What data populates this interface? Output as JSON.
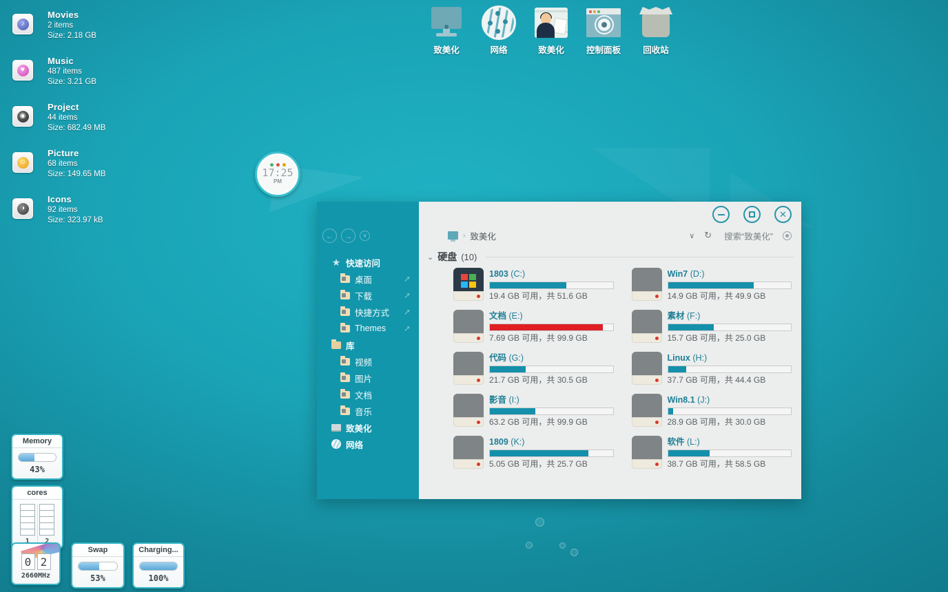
{
  "desktop": {
    "folders": [
      {
        "name": "Movies",
        "items": "2 items",
        "size": "Size: 2.18 GB",
        "glyph": "♪",
        "icon_name": "movies-folder-icon"
      },
      {
        "name": "Music",
        "items": "487 items",
        "size": "Size: 3.21 GB",
        "glyph": "♥",
        "icon_name": "music-folder-icon"
      },
      {
        "name": "Project",
        "items": "44 items",
        "size": "Size: 682.49 MB",
        "glyph": "◉",
        "icon_name": "project-folder-icon"
      },
      {
        "name": "Picture",
        "items": "68 items",
        "size": "Size: 149.65 MB",
        "glyph": "☺",
        "icon_name": "picture-folder-icon"
      },
      {
        "name": "Icons",
        "items": "92 items",
        "size": "Size: 323.97 kB",
        "glyph": "◑",
        "icon_name": "icons-folder-icon"
      }
    ],
    "top_icons": [
      {
        "label": "致美化",
        "icon_name": "computer-icon"
      },
      {
        "label": "网络",
        "icon_name": "network-globe-icon"
      },
      {
        "label": "致美化",
        "icon_name": "user-person-icon"
      },
      {
        "label": "控制面板",
        "icon_name": "control-panel-icon"
      },
      {
        "label": "回收站",
        "icon_name": "recycle-bin-icon"
      }
    ]
  },
  "clock": {
    "time": "17:25",
    "ampm": "PM",
    "dots": [
      "#49b36a",
      "#d9534f",
      "#e0a800"
    ]
  },
  "widgets": {
    "memory": {
      "title": "Memory",
      "value": "43%",
      "percent": 43
    },
    "cores": {
      "title": "cores",
      "labels": [
        "1",
        "2"
      ]
    },
    "cpu": {
      "digits": [
        "0",
        "2"
      ],
      "freq": "2660MHz"
    },
    "swap": {
      "title": "Swap",
      "value": "53%",
      "percent": 53
    },
    "battery": {
      "title": "Charging...",
      "value": "100%",
      "percent": 100
    }
  },
  "explorer": {
    "nav": {
      "back": "←",
      "forward": "→",
      "recent": "∨"
    },
    "window_controls": [
      {
        "name": "minimize-button",
        "glyph": "−"
      },
      {
        "name": "maximize-button",
        "glyph": "□"
      },
      {
        "name": "close-button",
        "glyph": "✕"
      }
    ],
    "address": {
      "path": "致美化",
      "separator": "›",
      "chevron": "∨",
      "refresh": "↻",
      "search_placeholder": "搜索“致美化”"
    },
    "sidebar": [
      {
        "label": "快速访问",
        "type": "head",
        "icon": "star-icon",
        "pinned": false
      },
      {
        "label": "桌面",
        "type": "child",
        "icon": "folder-icon",
        "pinned": true
      },
      {
        "label": "下载",
        "type": "child",
        "icon": "folder-icon",
        "pinned": true
      },
      {
        "label": "快捷方式",
        "type": "child",
        "icon": "folder-icon",
        "pinned": true
      },
      {
        "label": "Themes",
        "type": "child",
        "icon": "folder-icon",
        "pinned": true
      },
      {
        "label": "库",
        "type": "head",
        "icon": "library-icon",
        "pinned": false
      },
      {
        "label": "视频",
        "type": "child",
        "icon": "folder-icon",
        "pinned": false
      },
      {
        "label": "图片",
        "type": "child",
        "icon": "folder-icon",
        "pinned": false
      },
      {
        "label": "文档",
        "type": "child",
        "icon": "folder-icon",
        "pinned": false
      },
      {
        "label": "音乐",
        "type": "child",
        "icon": "folder-icon",
        "pinned": false
      },
      {
        "label": "致美化",
        "type": "head",
        "icon": "computer-icon",
        "pinned": false
      },
      {
        "label": "网络",
        "type": "head",
        "icon": "network-icon",
        "pinned": false
      }
    ],
    "group": {
      "caret": "⌄",
      "title": "硬盘",
      "count": "(10)"
    },
    "drives": [
      {
        "label": "1803",
        "letter": "(C:)",
        "used_percent": 62,
        "warn": false,
        "windows": true,
        "detail": "19.4 GB 可用，共 51.6 GB",
        "free": "19.4 GB",
        "total": "51.6 GB"
      },
      {
        "label": "Win7",
        "letter": "(D:)",
        "used_percent": 70,
        "warn": false,
        "windows": false,
        "detail": "14.9 GB 可用，共 49.9 GB",
        "free": "14.9 GB",
        "total": "49.9 GB"
      },
      {
        "label": "文档",
        "letter": "(E:)",
        "used_percent": 92,
        "warn": true,
        "windows": false,
        "detail": "7.69 GB 可用，共 99.9 GB",
        "free": "7.69 GB",
        "total": "99.9 GB"
      },
      {
        "label": "素材",
        "letter": "(F:)",
        "used_percent": 37,
        "warn": false,
        "windows": false,
        "detail": "15.7 GB 可用，共 25.0 GB",
        "free": "15.7 GB",
        "total": "25.0 GB"
      },
      {
        "label": "代码",
        "letter": "(G:)",
        "used_percent": 29,
        "warn": false,
        "windows": false,
        "detail": "21.7 GB 可用，共 30.5 GB",
        "free": "21.7 GB",
        "total": "30.5 GB"
      },
      {
        "label": "Linux",
        "letter": "(H:)",
        "used_percent": 15,
        "warn": false,
        "windows": false,
        "detail": "37.7 GB 可用，共 44.4 GB",
        "free": "37.7 GB",
        "total": "44.4 GB"
      },
      {
        "label": "影音",
        "letter": "(I:)",
        "used_percent": 37,
        "warn": false,
        "windows": false,
        "detail": "63.2 GB 可用，共 99.9 GB",
        "free": "63.2 GB",
        "total": "99.9 GB"
      },
      {
        "label": "Win8.1",
        "letter": "(J:)",
        "used_percent": 4,
        "warn": false,
        "windows": false,
        "detail": "28.9 GB 可用，共 30.0 GB",
        "free": "28.9 GB",
        "total": "30.0 GB"
      },
      {
        "label": "1809",
        "letter": "(K:)",
        "used_percent": 80,
        "warn": false,
        "windows": false,
        "detail": "5.05 GB 可用，共 25.7 GB",
        "free": "5.05 GB",
        "total": "25.7 GB"
      },
      {
        "label": "软件",
        "letter": "(L:)",
        "used_percent": 34,
        "warn": false,
        "windows": false,
        "detail": "38.7 GB 可用，共 58.5 GB",
        "free": "38.7 GB",
        "total": "58.5 GB"
      }
    ]
  },
  "colors": {
    "desktop_teal": "#1aa3b6",
    "accent_blue": "#1490ab",
    "warn_red": "#e01f24",
    "window_bg": "#eceded",
    "sidebar_bg": "#1296ab"
  }
}
